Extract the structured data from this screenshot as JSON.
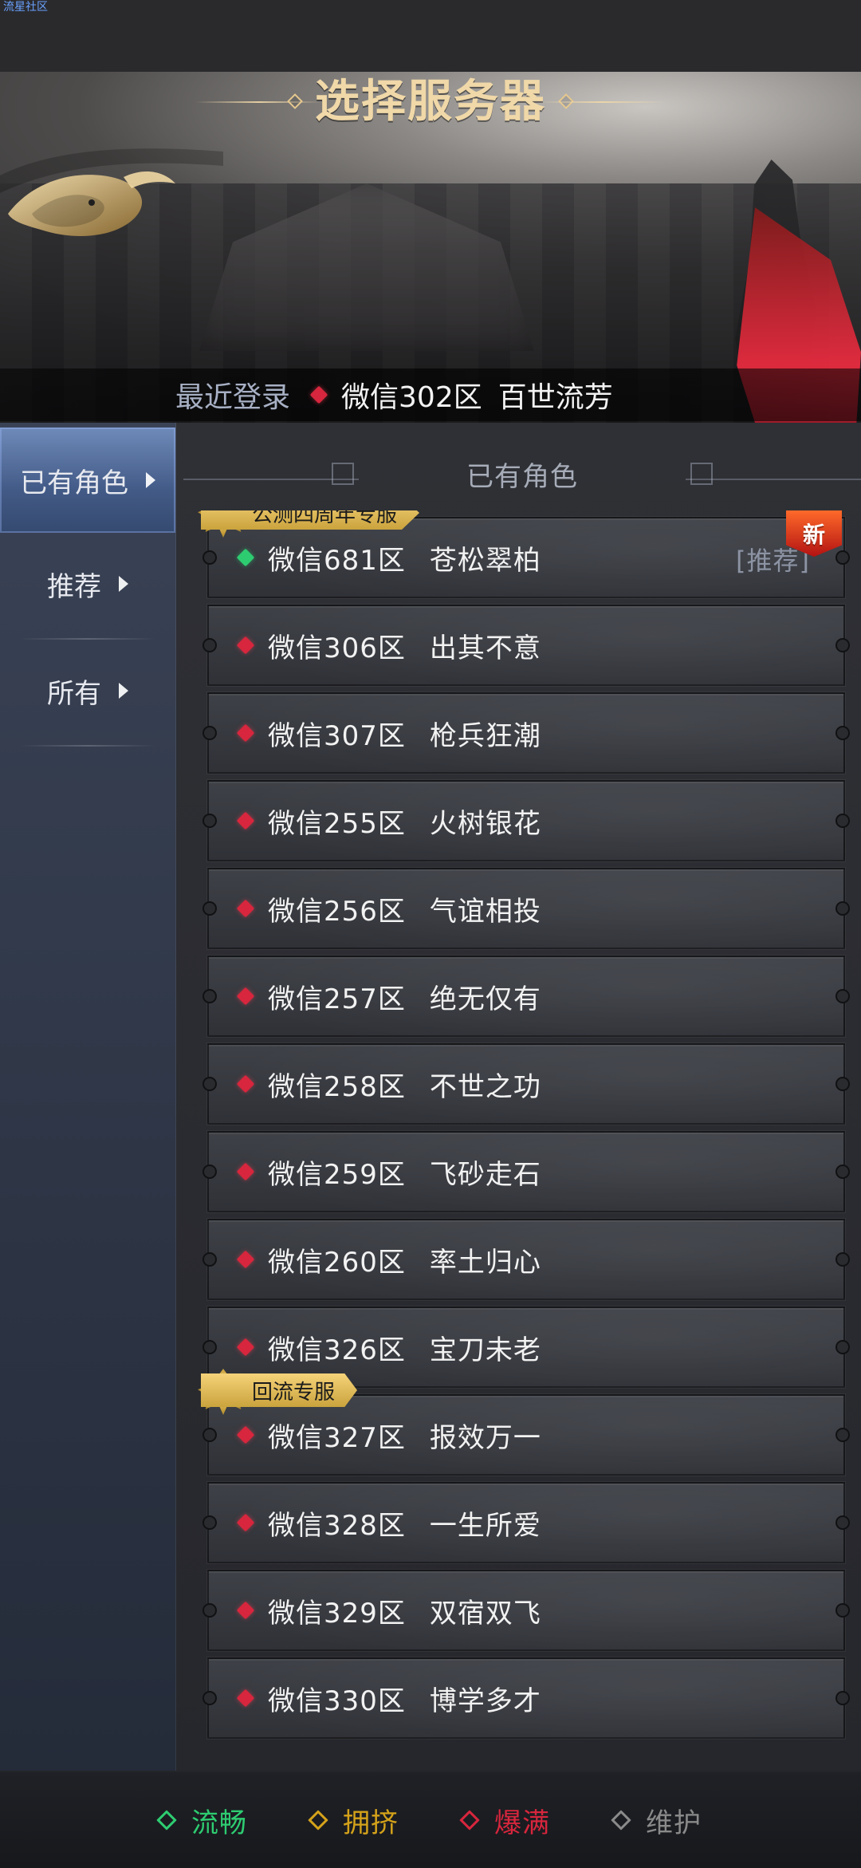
{
  "overlay": {
    "text": "流星社区"
  },
  "header": {
    "title": "选择服务器",
    "recent_label": "最近登录",
    "recent_zone": "微信302区",
    "recent_name": "百世流芳"
  },
  "sidebar": {
    "items": [
      {
        "label": "已有角色",
        "active": true
      },
      {
        "label": "推荐",
        "active": false
      },
      {
        "label": "所有",
        "active": false
      }
    ]
  },
  "content": {
    "title": "已有角色",
    "servers": [
      {
        "zone": "微信681区",
        "name": "苍松翠柏",
        "status": "green",
        "tag": "公测四周年专服",
        "recommend": "[推荐]",
        "new_badge": "新"
      },
      {
        "zone": "微信306区",
        "name": "出其不意",
        "status": "red"
      },
      {
        "zone": "微信307区",
        "name": "枪兵狂潮",
        "status": "red"
      },
      {
        "zone": "微信255区",
        "name": "火树银花",
        "status": "red"
      },
      {
        "zone": "微信256区",
        "name": "气谊相投",
        "status": "red"
      },
      {
        "zone": "微信257区",
        "name": "绝无仅有",
        "status": "red"
      },
      {
        "zone": "微信258区",
        "name": "不世之功",
        "status": "red"
      },
      {
        "zone": "微信259区",
        "name": "飞砂走石",
        "status": "red"
      },
      {
        "zone": "微信260区",
        "name": "率土归心",
        "status": "red"
      },
      {
        "zone": "微信326区",
        "name": "宝刀未老",
        "status": "red"
      },
      {
        "zone": "微信327区",
        "name": "报效万一",
        "status": "red",
        "tag": "回流专服"
      },
      {
        "zone": "微信328区",
        "name": "一生所爱",
        "status": "red"
      },
      {
        "zone": "微信329区",
        "name": "双宿双飞",
        "status": "red"
      },
      {
        "zone": "微信330区",
        "name": "博学多才",
        "status": "red"
      }
    ]
  },
  "legend": {
    "items": [
      {
        "label": "流畅",
        "color": "#2ecc71"
      },
      {
        "label": "拥挤",
        "color": "#d4a21a"
      },
      {
        "label": "爆满",
        "color": "#d7263d"
      },
      {
        "label": "维护",
        "color": "#8a8a8a"
      }
    ]
  }
}
